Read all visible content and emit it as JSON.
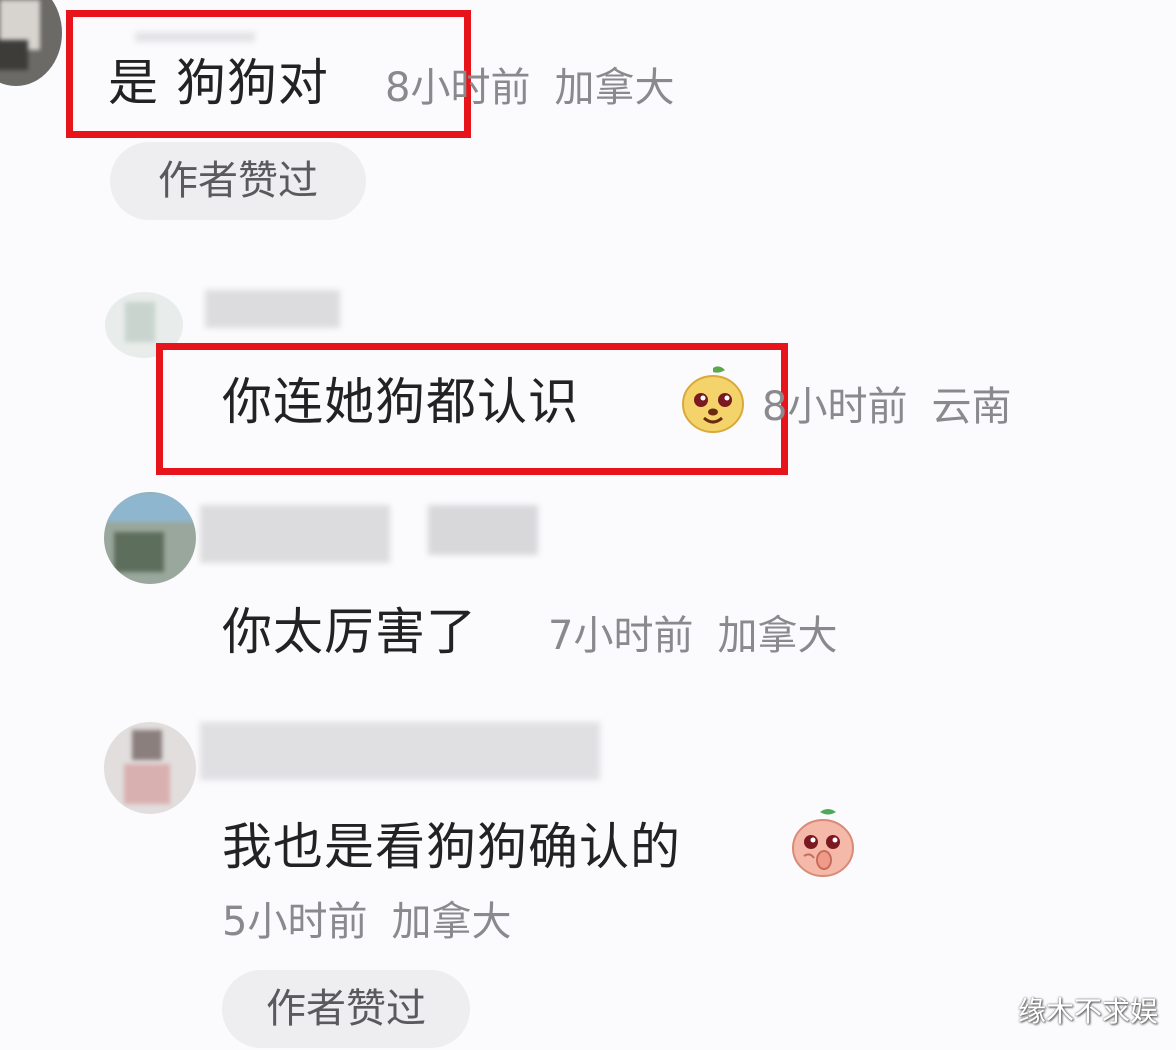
{
  "comments": [
    {
      "text": "是 狗狗对",
      "time": "8小时前",
      "location": "加拿大",
      "author_liked": "作者赞过"
    },
    {
      "text": "你连她狗都认识",
      "time": "8小时前",
      "location": "云南",
      "emoji": "dog-face-emoji"
    },
    {
      "text": "你太厉害了",
      "time": "7小时前",
      "location": "加拿大"
    },
    {
      "text": "我也是看狗狗确认的",
      "time": "5小时前",
      "location": "加拿大",
      "emoji": "peach-face-emoji",
      "author_liked": "作者赞过"
    }
  ],
  "watermark": "缘木不求娱",
  "colors": {
    "highlight": "#e8141c",
    "meta_text": "#8a8a8e",
    "pill_bg": "#eeeef0"
  }
}
